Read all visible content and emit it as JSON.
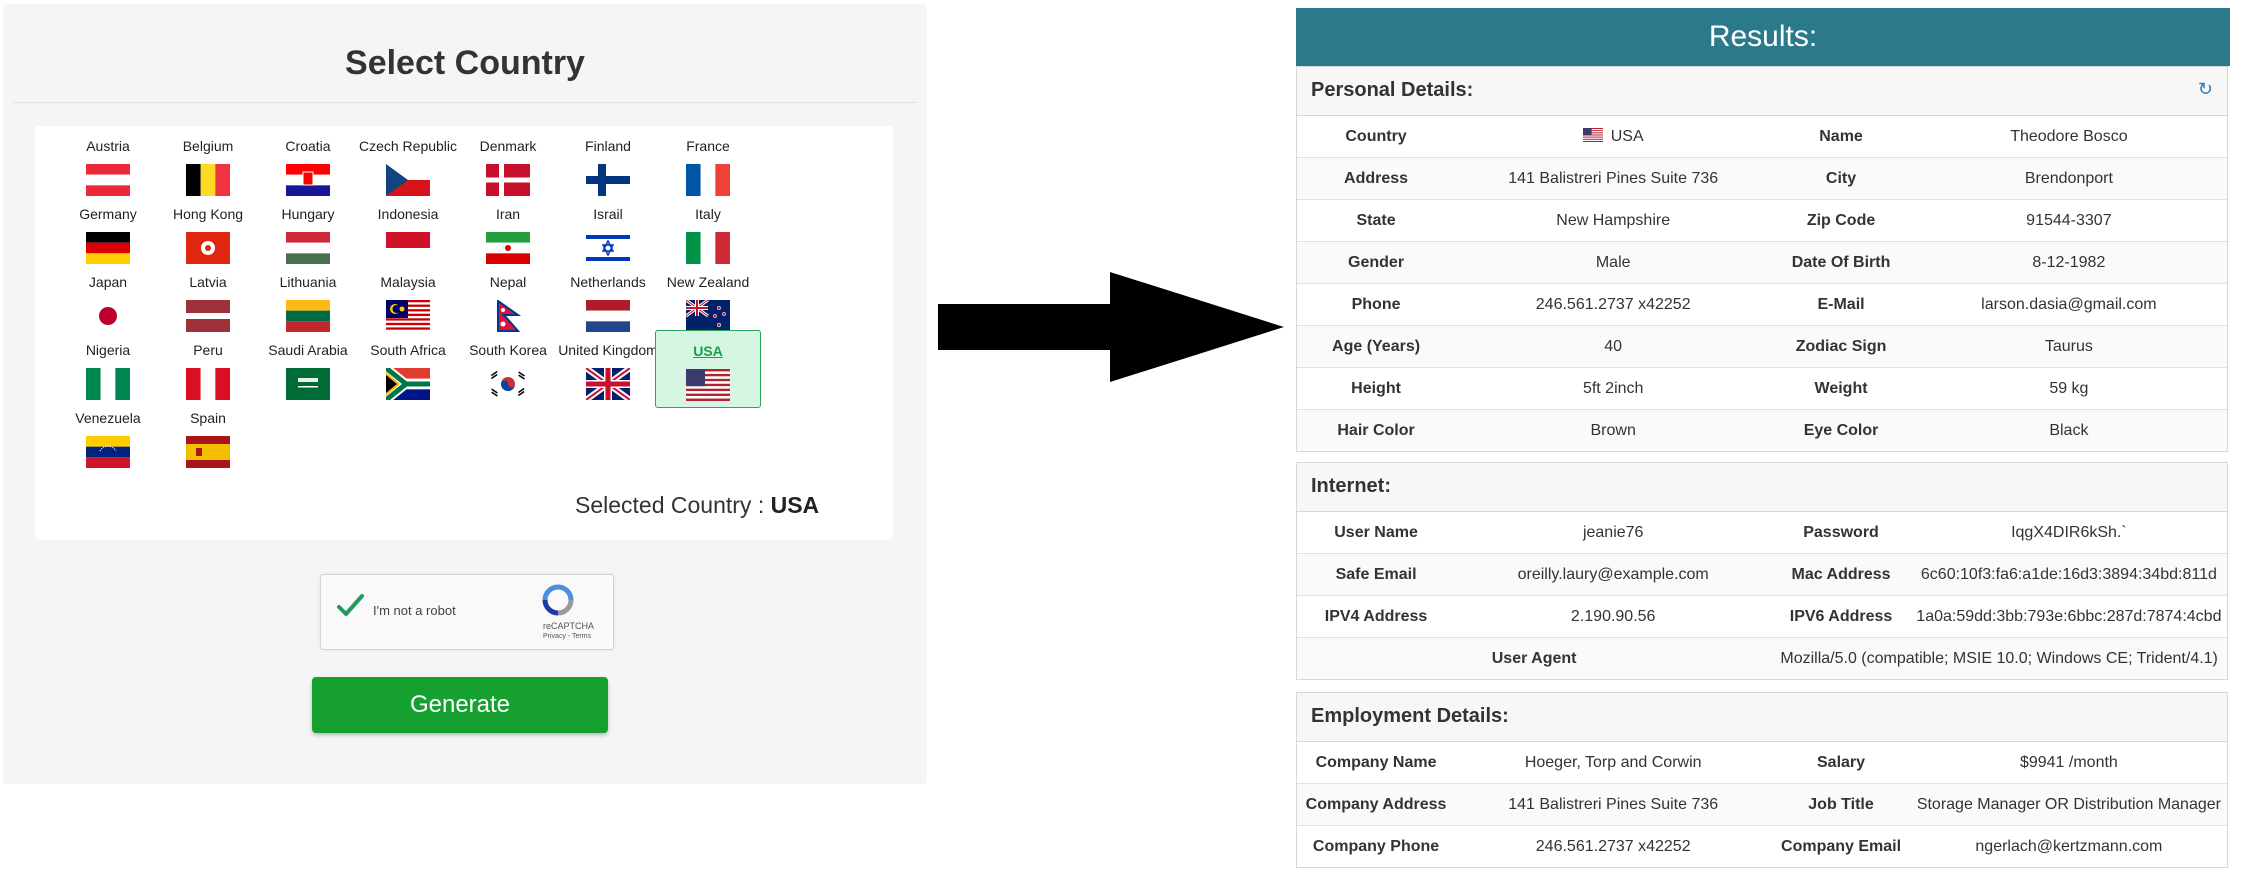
{
  "left": {
    "title": "Select Country",
    "countries": [
      {
        "name": "Austria",
        "flag": "austria"
      },
      {
        "name": "Belgium",
        "flag": "belgium"
      },
      {
        "name": "Croatia",
        "flag": "croatia"
      },
      {
        "name": "Czech Republic",
        "flag": "czech"
      },
      {
        "name": "Denmark",
        "flag": "denmark"
      },
      {
        "name": "Finland",
        "flag": "finland"
      },
      {
        "name": "France",
        "flag": "france"
      },
      {
        "name": "Germany",
        "flag": "germany"
      },
      {
        "name": "Hong Kong",
        "flag": "hongkong"
      },
      {
        "name": "Hungary",
        "flag": "hungary"
      },
      {
        "name": "Indonesia",
        "flag": "indonesia"
      },
      {
        "name": "Iran",
        "flag": "iran"
      },
      {
        "name": "Israil",
        "flag": "israel"
      },
      {
        "name": "Italy",
        "flag": "italy"
      },
      {
        "name": "Japan",
        "flag": "japan"
      },
      {
        "name": "Latvia",
        "flag": "latvia"
      },
      {
        "name": "Lithuania",
        "flag": "lithuania"
      },
      {
        "name": "Malaysia",
        "flag": "malaysia"
      },
      {
        "name": "Nepal",
        "flag": "nepal"
      },
      {
        "name": "Netherlands",
        "flag": "netherlands"
      },
      {
        "name": "New Zealand",
        "flag": "newzealand"
      },
      {
        "name": "Nigeria",
        "flag": "nigeria"
      },
      {
        "name": "Peru",
        "flag": "peru"
      },
      {
        "name": "Saudi Arabia",
        "flag": "saudi"
      },
      {
        "name": "South Africa",
        "flag": "southafrica"
      },
      {
        "name": "South Korea",
        "flag": "southkorea"
      },
      {
        "name": "United Kingdom",
        "flag": "uk"
      },
      {
        "name": "USA",
        "flag": "usa",
        "selected": true
      },
      {
        "name": "Venezuela",
        "flag": "venezuela"
      },
      {
        "name": "Spain",
        "flag": "spain"
      }
    ],
    "selected_label": "Selected Country :",
    "selected_value": "USA",
    "captcha": {
      "label": "I'm not a robot",
      "brand": "reCAPTCHA",
      "terms": "Privacy - Terms"
    },
    "generate_label": "Generate"
  },
  "results": {
    "title": "Results:",
    "personal": {
      "title": "Personal Details:",
      "rows": [
        [
          {
            "k": "Country"
          },
          {
            "v": "USA",
            "flag": "usa"
          },
          {
            "k": "Name"
          },
          {
            "v": "Theodore Bosco"
          }
        ],
        [
          {
            "k": "Address"
          },
          {
            "v": "141 Balistreri Pines Suite 736"
          },
          {
            "k": "City"
          },
          {
            "v": "Brendonport"
          }
        ],
        [
          {
            "k": "State"
          },
          {
            "v": "New Hampshire"
          },
          {
            "k": "Zip Code"
          },
          {
            "v": "91544-3307"
          }
        ],
        [
          {
            "k": "Gender"
          },
          {
            "v": "Male"
          },
          {
            "k": "Date Of Birth"
          },
          {
            "v": "8-12-1982"
          }
        ],
        [
          {
            "k": "Phone"
          },
          {
            "v": "246.561.2737 x42252"
          },
          {
            "k": "E-Mail"
          },
          {
            "v": "larson.dasia@gmail.com"
          }
        ],
        [
          {
            "k": "Age (Years)"
          },
          {
            "v": "40"
          },
          {
            "k": "Zodiac Sign"
          },
          {
            "v": "Taurus"
          }
        ],
        [
          {
            "k": "Height"
          },
          {
            "v": "5ft 2inch"
          },
          {
            "k": "Weight"
          },
          {
            "v": "59 kg"
          }
        ],
        [
          {
            "k": "Hair Color"
          },
          {
            "v": "Brown"
          },
          {
            "k": "Eye Color"
          },
          {
            "v": "Black"
          }
        ]
      ]
    },
    "internet": {
      "title": "Internet:",
      "rows": [
        [
          {
            "k": "User Name"
          },
          {
            "v": "jeanie76"
          },
          {
            "k": "Password"
          },
          {
            "v": "IqgX4DIR6kSh.`"
          }
        ],
        [
          {
            "k": "Safe Email"
          },
          {
            "v": "oreilly.laury@example.com"
          },
          {
            "k": "Mac Address"
          },
          {
            "v": "6c60:10f3:fa6:a1de:16d3:3894:34bd:811d"
          }
        ],
        [
          {
            "k": "IPV4 Address"
          },
          {
            "v": "2.190.90.56"
          },
          {
            "k": "IPV6 Address"
          },
          {
            "v": "1a0a:59dd:3bb:793e:6bbc:287d:7874:4cbd"
          }
        ]
      ],
      "user_agent_label": "User Agent",
      "user_agent_value": "Mozilla/5.0 (compatible; MSIE 10.0; Windows CE; Trident/4.1)"
    },
    "employment": {
      "title": "Employment Details:",
      "rows": [
        [
          {
            "k": "Company Name"
          },
          {
            "v": "Hoeger, Torp and Corwin"
          },
          {
            "k": "Salary"
          },
          {
            "v": "$9941 /month"
          }
        ],
        [
          {
            "k": "Company Address"
          },
          {
            "v": "141 Balistreri Pines Suite 736"
          },
          {
            "k": "Job Title"
          },
          {
            "v": "Storage Manager OR Distribution Manager"
          }
        ],
        [
          {
            "k": "Company Phone"
          },
          {
            "v": "246.561.2737 x42252"
          },
          {
            "k": "Company Email"
          },
          {
            "v": "ngerlach@kertzmann.com"
          }
        ]
      ]
    }
  }
}
